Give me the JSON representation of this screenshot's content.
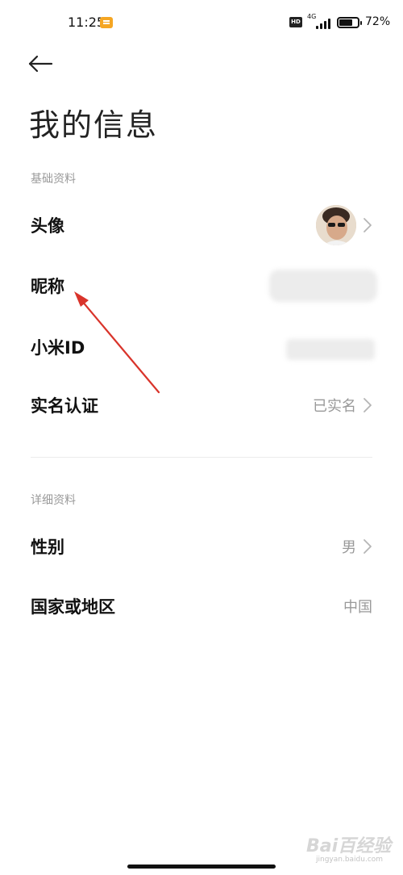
{
  "status_bar": {
    "time": "11:25",
    "network": "4G",
    "hd": "HD",
    "battery": "72%",
    "battery_level": 0.72
  },
  "header": {
    "title": "我的信息"
  },
  "sections": {
    "basic": {
      "label": "基础资料",
      "rows": {
        "avatar": {
          "label": "头像"
        },
        "nickname": {
          "label": "昵称"
        },
        "mi_id": {
          "label": "小米ID"
        },
        "real_name": {
          "label": "实名认证",
          "value": "已实名"
        }
      }
    },
    "detail": {
      "label": "详细资料",
      "rows": {
        "gender": {
          "label": "性别",
          "value": "男"
        },
        "region": {
          "label": "国家或地区",
          "value": "中国"
        }
      }
    }
  },
  "watermark": {
    "text": "Bai百经验",
    "sub": "jingyan.baidu.com"
  },
  "colors": {
    "annotation": "#d9342b",
    "secondary_text": "#999999"
  }
}
